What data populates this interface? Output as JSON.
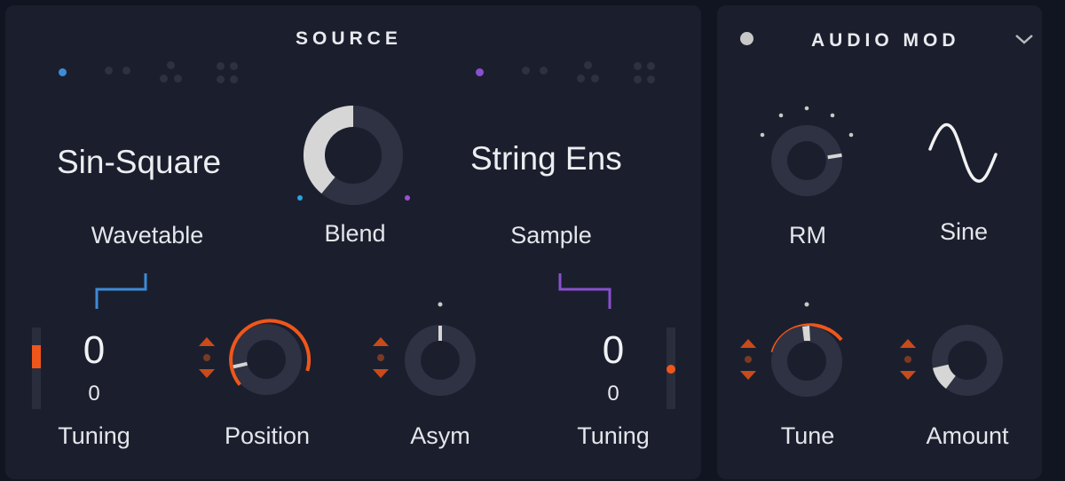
{
  "source": {
    "title": "SOURCE",
    "osc_a": {
      "name": "Sin-Square",
      "type_label": "Wavetable",
      "accent": "#3e8bd6",
      "voice_modes": [
        "1-voice",
        "2-voice",
        "3-voice",
        "4-voice"
      ],
      "selected_voice_mode": 0,
      "tuning": {
        "value": "0",
        "fine": "0",
        "label": "Tuning",
        "level": 0.3
      },
      "position": {
        "label": "Position",
        "value": 0.12
      },
      "asym": {
        "label": "Asym",
        "value": 0.5
      }
    },
    "osc_b": {
      "name": "String Ens",
      "type_label": "Sample",
      "accent": "#8a4fd0",
      "voice_modes": [
        "1-voice",
        "2-voice",
        "3-voice",
        "4-voice"
      ],
      "selected_voice_mode": 0,
      "tuning": {
        "value": "0",
        "fine": "0",
        "label": "Tuning",
        "level": 0.5
      }
    },
    "blend": {
      "label": "Blend",
      "value": 0.39
    }
  },
  "audio_mod": {
    "title": "AUDIO MOD",
    "rm": {
      "label": "RM",
      "value": 0.8
    },
    "waveform": {
      "label": "Sine"
    },
    "tune": {
      "label": "Tune",
      "value": 0.5
    },
    "amount": {
      "label": "Amount",
      "value": 0.12
    }
  },
  "colors": {
    "orange": "#f0561a",
    "knob_track": "#2e3242",
    "knob_fill": "#d6d6d6",
    "blue": "#3e8bd6",
    "purple": "#8a4fd0"
  }
}
